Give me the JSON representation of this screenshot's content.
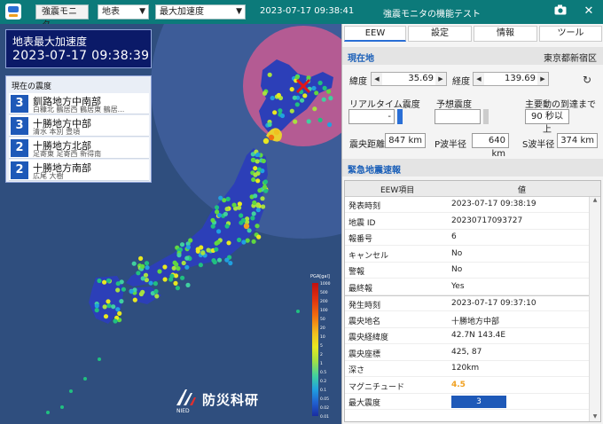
{
  "window": {
    "mode_button": "強震モニタ",
    "layer_select": "地表",
    "value_select": "最大加速度",
    "datetime": "2023-07-17 09:38:41",
    "title": "強震モニタの機能テスト"
  },
  "map_header": {
    "title": "地表最大加速度",
    "time": "2023-07-17 09:38:39"
  },
  "intensity_list": {
    "heading": "現在の震度",
    "items": [
      {
        "intensity": "3",
        "region": "釧路地方中南部",
        "stations": "白糠北 鶴居西 鶴居東 鶴居..."
      },
      {
        "intensity": "3",
        "region": "十勝地方中部",
        "stations": "清水 本別 豊頃"
      },
      {
        "intensity": "2",
        "region": "十勝地方北部",
        "stations": "足寄東 足寄西 新得南"
      },
      {
        "intensity": "2",
        "region": "十勝地方南部",
        "stations": "広尾 大樹"
      }
    ]
  },
  "logo": {
    "text": "防災科研",
    "sub": "NIED"
  },
  "legend": {
    "title": "PGA[gal]",
    "ticks": [
      "1000",
      "500",
      "200",
      "100",
      "50",
      "20",
      "10",
      "5",
      "2",
      "1",
      "0.5",
      "0.2",
      "0.1",
      "0.05",
      "0.02",
      "0.01"
    ]
  },
  "tabs": [
    "EEW",
    "設定",
    "情報",
    "ツール"
  ],
  "current_location": {
    "section_label": "現在地",
    "place": "東京都新宿区",
    "lat_label": "緯度",
    "lat_value": "35.69",
    "lon_label": "経度",
    "lon_value": "139.69",
    "realtime_label": "リアルタイム震度",
    "realtime_value": "-",
    "forecast_label": "予想震度",
    "forecast_value": "",
    "arrival_label": "主要動の到達まで",
    "arrival_value": "90 秒以上",
    "distance_label": "震央距離",
    "distance_value": "847 km",
    "p_label": "P波半径",
    "p_value": "640 km",
    "s_label": "S波半径",
    "s_value": "374 km"
  },
  "eew": {
    "section_label": "緊急地震速報",
    "col_key": "EEW項目",
    "col_value": "値",
    "rows": [
      {
        "key": "発表時刻",
        "value": "2023-07-17 09:38:19"
      },
      {
        "key": "地震 ID",
        "value": "20230717093727"
      },
      {
        "key": "報番号",
        "value": "6"
      },
      {
        "key": "キャンセル",
        "value": "No"
      },
      {
        "key": "警報",
        "value": "No"
      },
      {
        "key": "最終報",
        "value": "Yes"
      },
      {
        "key": "発生時刻",
        "value": "2023-07-17 09:37:10"
      },
      {
        "key": "震央地名",
        "value": "十勝地方中部"
      },
      {
        "key": "震央経緯度",
        "value": "42.7N 143.4E"
      },
      {
        "key": "震央座標",
        "value": "425, 87"
      },
      {
        "key": "深さ",
        "value": "120km"
      },
      {
        "key": "マグニチュード",
        "value": "4.5"
      },
      {
        "key": "最大震度",
        "value": "3"
      }
    ]
  },
  "colors": {
    "teal": "#0c7a7a",
    "navy": "#0b1a68",
    "intensity_blue": "#1e59b8",
    "magnitude": "#f0a020",
    "sea": "#2f4e7e",
    "land": "#2c3fb8"
  }
}
